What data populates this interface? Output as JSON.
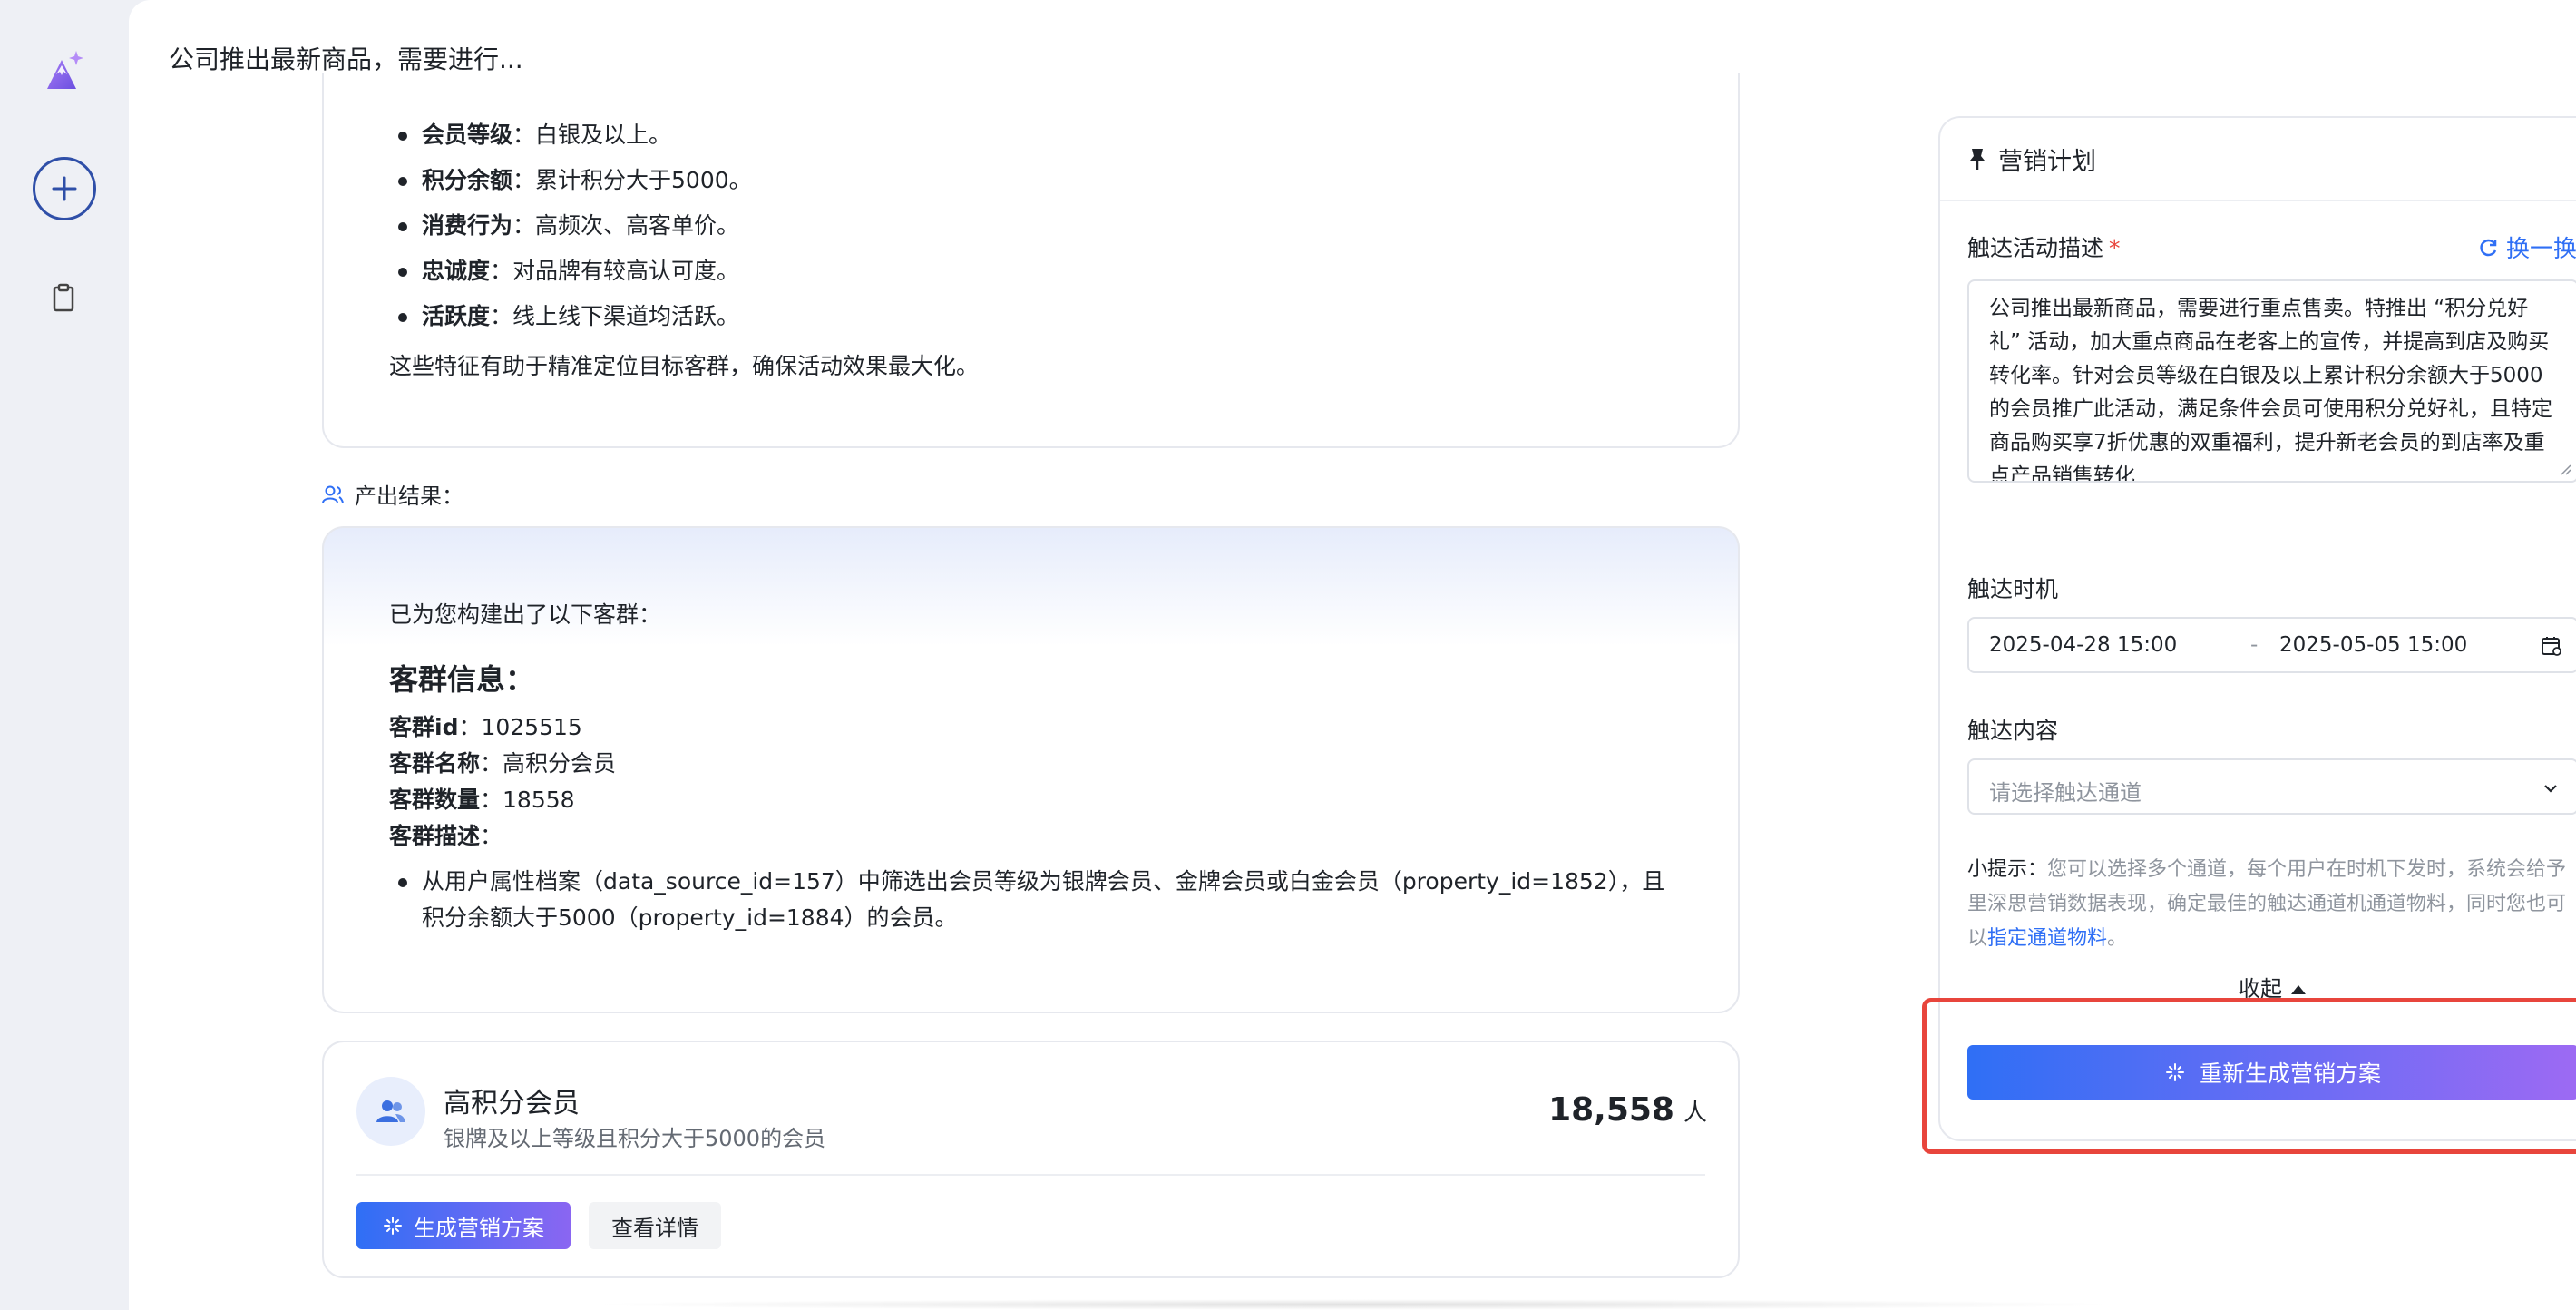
{
  "page": {
    "title": "公司推出最新商品，需要进行..."
  },
  "traits": {
    "items": [
      {
        "label": "会员等级",
        "value": "：白银及以上。"
      },
      {
        "label": "积分余额",
        "value": "：累计积分大于5000。"
      },
      {
        "label": "消费行为",
        "value": "：高频次、高客单价。"
      },
      {
        "label": "忠诚度",
        "value": "：对品牌有较高认可度。"
      },
      {
        "label": "活跃度",
        "value": "：线上线下渠道均活跃。"
      }
    ],
    "summary": "这些特征有助于精准定位目标客群，确保活动效果最大化。"
  },
  "output": {
    "label": "产出结果：",
    "built_text": "已为您构建出了以下客群：",
    "info_title": "客群信息：",
    "rows": [
      {
        "label": "客群id",
        "value": "：1025515"
      },
      {
        "label": "客群名称",
        "value": "：高积分会员"
      },
      {
        "label": "客群数量",
        "value": "：18558"
      },
      {
        "label": "客群描述",
        "value": "："
      }
    ],
    "description": "从用户属性档案（data_source_id=157）中筛选出会员等级为银牌会员、金牌会员或白金会员（property_id=1852），且积分余额大于5000（property_id=1884）的会员。"
  },
  "segment": {
    "name": "高积分会员",
    "desc": "银牌及以上等级且积分大于5000的会员",
    "count": "18,558",
    "unit": "人",
    "generate_label": "生成营销方案",
    "detail_label": "查看详情"
  },
  "plan": {
    "title": "营销计划",
    "desc_label": "触达活动描述",
    "required_mark": "*",
    "swap_label": "换一换",
    "desc_text": "公司推出最新商品，需要进行重点售卖。特推出 “积分兑好礼” 活动，加大重点商品在老客上的宣传，并提高到店及购买转化率。针对会员等级在白银及以上累计积分余额大于5000的会员推广此活动，满足条件会员可使用积分兑好礼，且特定商品购买享7折优惠的双重福利，提升新老会员的到店率及重点产品销售转化",
    "time_label": "触达时机",
    "date_start": "2025-04-28 15:00",
    "date_sep": "-",
    "date_end": "2025-05-05 15:00",
    "content_label": "触达内容",
    "select_placeholder": "请选择触达通道",
    "tip_label": "小提示：",
    "tip_text": "您可以选择多个通道，每个用户在时机下发时，系统会给予里深思营销数据表现，确定最佳的触达通道机通道物料，同时您也可以",
    "tip_link": "指定通道物料",
    "tip_end": "。",
    "collapse_label": "收起",
    "regen_label": "重新生成营销方案"
  },
  "icons": {
    "logo": "mountain-sparkle-logo",
    "new": "plus-icon",
    "clipboard": "clipboard-icon",
    "pin": "pin-icon",
    "users": "users-icon",
    "sparkle": "sparkle-icon",
    "refresh": "refresh-icon",
    "calendar": "calendar-icon",
    "chevron": "chevron-down-icon"
  },
  "colors": {
    "accent": "#2f6ff5",
    "gradient_end": "#9d6af3",
    "highlight": "#e8453c"
  }
}
